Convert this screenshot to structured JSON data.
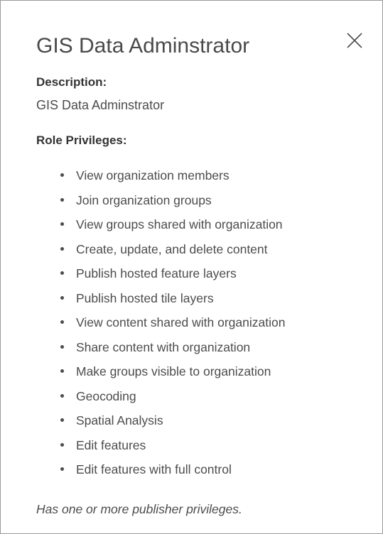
{
  "dialog": {
    "title": "GIS Data Adminstrator",
    "close_icon": "close-icon",
    "description_label": "Description:",
    "description_value": "GIS Data Adminstrator",
    "privileges_label": "Role Privileges:",
    "privileges": [
      "View organization members",
      "Join organization groups",
      "View groups shared with organization",
      "Create, update, and delete content",
      "Publish hosted feature layers",
      "Publish hosted tile layers",
      "View content shared with organization",
      "Share content with organization",
      "Make groups visible to organization",
      "Geocoding",
      "Spatial Analysis",
      "Edit features",
      "Edit features with full control"
    ],
    "footnote": "Has one or more publisher privileges."
  },
  "colors": {
    "text": "#4c4c4c",
    "heading": "#333333",
    "border": "#9a9a9a",
    "background": "#ffffff"
  }
}
